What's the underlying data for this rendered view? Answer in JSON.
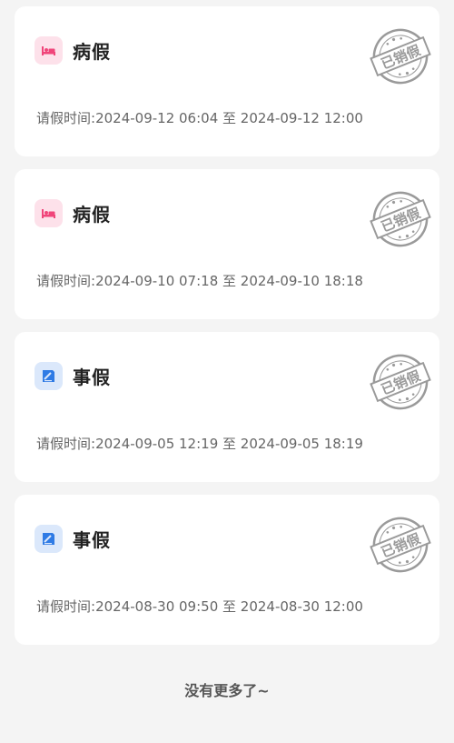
{
  "records": [
    {
      "type": "病假",
      "kind": "sick",
      "icon": "bed-icon",
      "time_label": "请假时间:",
      "start": "2024-09-12 06:04",
      "sep": " 至 ",
      "end": "2024-09-12 12:00",
      "stamp_text": "已销假"
    },
    {
      "type": "病假",
      "kind": "sick",
      "icon": "bed-icon",
      "time_label": "请假时间:",
      "start": "2024-09-10 07:18",
      "sep": " 至 ",
      "end": "2024-09-10 18:18",
      "stamp_text": "已销假"
    },
    {
      "type": "事假",
      "kind": "personal",
      "icon": "document-icon",
      "time_label": "请假时间:",
      "start": "2024-09-05 12:19",
      "sep": " 至 ",
      "end": "2024-09-05 18:19",
      "stamp_text": "已销假"
    },
    {
      "type": "事假",
      "kind": "personal",
      "icon": "document-icon",
      "time_label": "请假时间:",
      "start": "2024-08-30 09:50",
      "sep": " 至 ",
      "end": "2024-08-30 12:00",
      "stamp_text": "已销假"
    }
  ],
  "footer": {
    "text": "没有更多了~"
  },
  "colors": {
    "sick_icon": "#f0457a",
    "sick_bg": "#fde1ea",
    "personal_icon": "#2f7be5",
    "personal_bg": "#dbe8fb",
    "stamp": "#9a9a9a"
  }
}
